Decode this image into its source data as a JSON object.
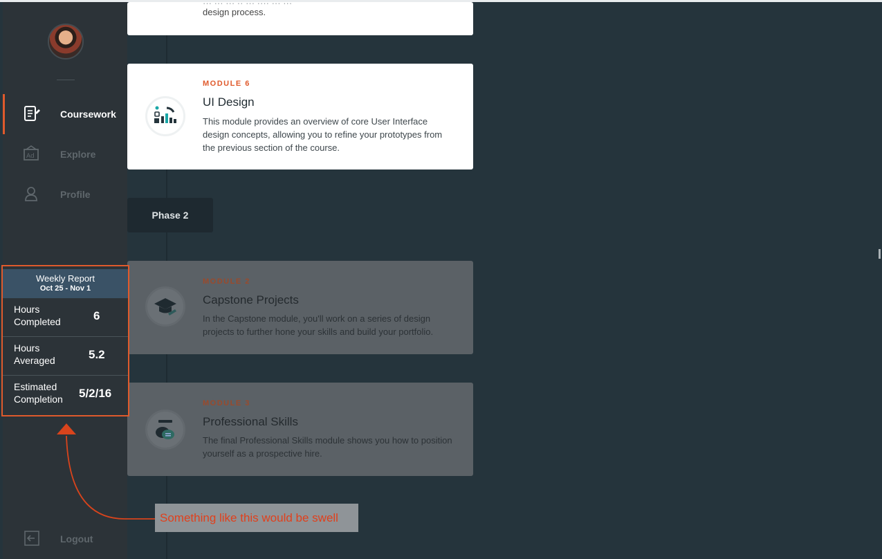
{
  "sidebar": {
    "items": [
      {
        "label": "Coursework",
        "icon": "notebook-icon",
        "active": true
      },
      {
        "label": "Explore",
        "icon": "easel-icon",
        "active": false
      },
      {
        "label": "Profile",
        "icon": "person-icon",
        "active": false
      }
    ],
    "logout_label": "Logout"
  },
  "weekly_report": {
    "title": "Weekly Report",
    "dates": "Oct 25 - Nov 1",
    "rows": [
      {
        "label": "Hours Completed",
        "value": "6"
      },
      {
        "label": "Hours Averaged",
        "value": "5.2"
      },
      {
        "label": "Estimated Completion",
        "value": "5/2/16"
      }
    ]
  },
  "timeline": {
    "top_card_desc": "design process.",
    "phase_label": "Phase 2",
    "modules": [
      {
        "kicker": "MODULE 6",
        "title": "UI Design",
        "description": "This module provides an overview of core User Interface design concepts, allowing you to refine your prototypes from the previous section of the course.",
        "icon": "bar-chart-icon"
      },
      {
        "kicker": "MODULE 2",
        "title": "Capstone Projects",
        "description": "In the Capstone module, you'll work on a series of design projects to further hone your skills and build your portfolio.",
        "icon": "graduation-cap-icon"
      },
      {
        "kicker": "MODULE 3",
        "title": "Professional Skills",
        "description": "The final Professional Skills module shows you how to position yourself as a prospective hire.",
        "icon": "chat-bubbles-icon"
      }
    ]
  },
  "annotation": {
    "text": "Something like this would be swell"
  },
  "colors": {
    "accent": "#e05a2c",
    "background": "#25343c",
    "sidebar": "#2c3338",
    "report_header": "#3a5266"
  }
}
